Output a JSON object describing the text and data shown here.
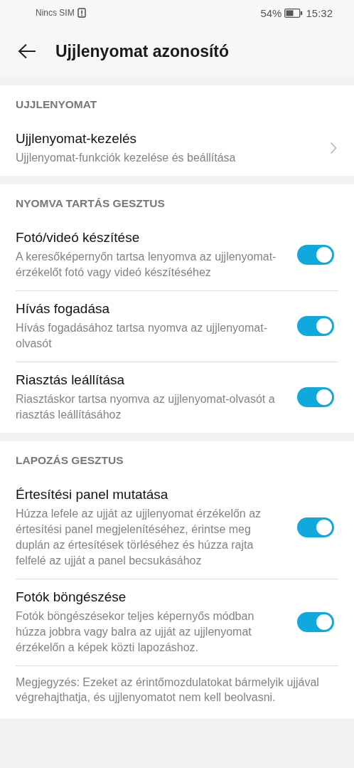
{
  "status_bar": {
    "carrier": "Nincs SIM",
    "battery": "54%",
    "time": "15:32"
  },
  "header": {
    "title": "Ujjlenyomat azonosító"
  },
  "sections": [
    {
      "title": "UJJLENYOMAT",
      "items": [
        {
          "kind": "link",
          "title": "Ujjlenyomat-kezelés",
          "description": "Ujjlenyomat-funkciók kezelése és beállítása"
        }
      ]
    },
    {
      "title": "NYOMVA TARTÁS GESZTUS",
      "items": [
        {
          "kind": "switch",
          "title": "Fotó/videó készítése",
          "description": "A keresőképernyőn tartsa lenyomva az ujjlenyomat-érzékelőt fotó vagy videó készítéséhez",
          "on": true
        },
        {
          "kind": "switch",
          "title": "Hívás fogadása",
          "description": "Hívás fogadásához tartsa nyomva az ujjlenyomat-olvasót",
          "on": true
        },
        {
          "kind": "switch",
          "title": "Riasztás leállítása",
          "description": "Riasztáskor tartsa nyomva az ujjlenyomat-olvasót a riasztás leállításához",
          "on": true
        }
      ]
    },
    {
      "title": "LAPOZÁS GESZTUS",
      "items": [
        {
          "kind": "switch",
          "title": "Értesítési panel mutatása",
          "description": "Húzza lefele az ujját az ujjlenyomat érzékelőn az értesítési panel megjelenítéséhez, érintse meg duplán az értesítések törléséhez és húzza rajta felfelé az ujját a panel becsukásához",
          "on": true
        },
        {
          "kind": "switch",
          "title": "Fotók böngészése",
          "description": "Fotók böngészésekor teljes képernyős módban húzza jobbra vagy balra az ujját az ujjlenyomat érzékelőn a képek közti lapozáshoz.",
          "on": true
        }
      ],
      "note": "Megjegyzés: Ezeket az érintőmozdulatokat bármelyik ujjával végrehajthatja, és ujjlenyomatot nem kell beolvasni."
    }
  ]
}
